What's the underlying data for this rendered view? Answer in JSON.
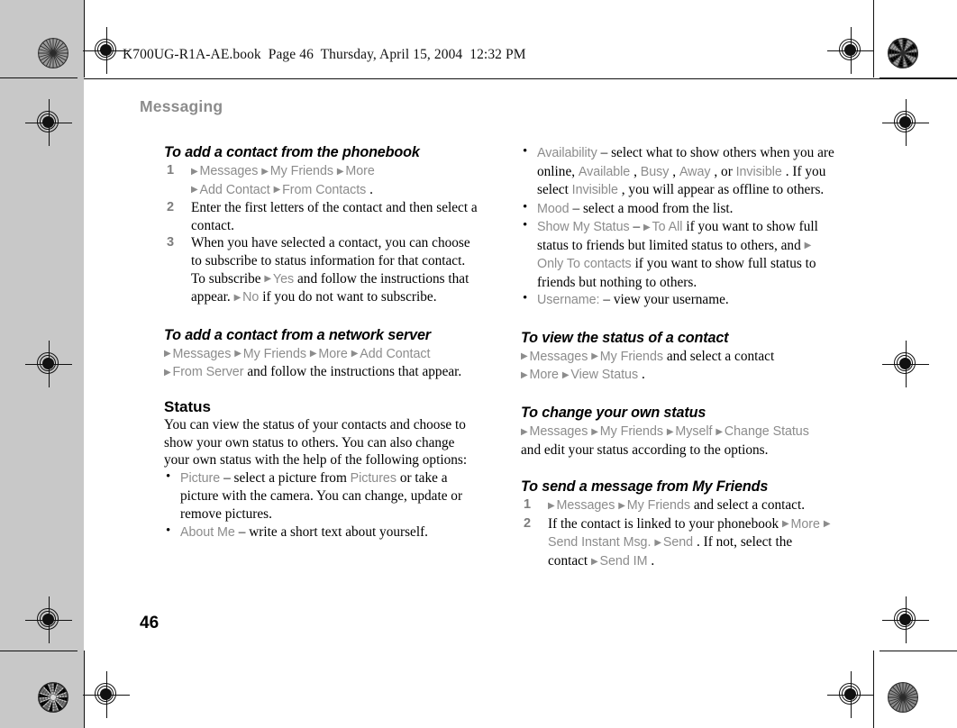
{
  "proof": {
    "file_header": "K700UG-R1A-AE.book  Page 46  Thursday, April 15, 2004  12:32 PM",
    "folio": "46",
    "running_head": "Messaging",
    "arrow_glyph": "▶",
    "bullet_glyph": "•",
    "colors": {
      "ui_gray": "#8c8c8c",
      "head_gray": "#8c8c8c",
      "body_black": "#000000",
      "proof_background": "#c8c8c8",
      "page_white": "#ffffff"
    }
  },
  "left_column": {
    "section_1": {
      "heading": "To add a contact from the phonebook",
      "steps": [
        {
          "number": "1",
          "line1": [
            {
              "t": "arrow"
            },
            {
              "t": "ui",
              "v": "Messages"
            },
            {
              "t": "arrow"
            },
            {
              "t": "ui",
              "v": "My Friends"
            },
            {
              "t": "arrow"
            },
            {
              "t": "ui",
              "v": "More"
            }
          ],
          "line2": [
            {
              "t": "arrow"
            },
            {
              "t": "ui",
              "v": "Add Contact"
            },
            {
              "t": "arrow"
            },
            {
              "t": "ui",
              "v": "From Contacts"
            },
            {
              "t": "text",
              "v": "."
            }
          ]
        },
        {
          "number": "2",
          "text": "Enter the first letters of the contact and then select a contact."
        },
        {
          "number": "3",
          "parts": [
            {
              "t": "text",
              "v": "When you have selected a contact, you can choose to subscribe to status information for that contact. To subscribe "
            },
            {
              "t": "arrow"
            },
            {
              "t": "ui",
              "v": "Yes"
            },
            {
              "t": "text",
              "v": " and follow the instructions that appear. "
            },
            {
              "t": "arrow"
            },
            {
              "t": "ui",
              "v": "No"
            },
            {
              "t": "text",
              "v": " if you do not want to subscribe."
            }
          ]
        }
      ]
    },
    "section_2": {
      "heading": "To add a contact from a network server",
      "body": [
        {
          "t": "arrow"
        },
        {
          "t": "ui",
          "v": "Messages"
        },
        {
          "t": "arrow"
        },
        {
          "t": "ui",
          "v": "My Friends"
        },
        {
          "t": "arrow"
        },
        {
          "t": "ui",
          "v": "More"
        },
        {
          "t": "arrow"
        },
        {
          "t": "ui",
          "v": "Add Contact"
        },
        {
          "t": "break"
        },
        {
          "t": "arrow"
        },
        {
          "t": "ui",
          "v": "From Server"
        },
        {
          "t": "text",
          "v": " and follow the instructions that appear."
        }
      ]
    },
    "section_3": {
      "heading": "Status",
      "intro": "You can view the status of your contacts and choose to show your own status to others. You can also change your own status with the help of the following options:",
      "bullets": [
        [
          {
            "t": "ui",
            "v": "Picture"
          },
          {
            "t": "text",
            "v": " – select a picture from "
          },
          {
            "t": "ui",
            "v": "Pictures"
          },
          {
            "t": "text",
            "v": " or take a picture with the camera. You can change, update or remove pictures."
          }
        ],
        [
          {
            "t": "ui",
            "v": "About Me"
          },
          {
            "t": "text",
            "v": " – write a short text about yourself."
          }
        ]
      ]
    }
  },
  "right_column": {
    "bullets_continued": [
      [
        {
          "t": "ui",
          "v": "Availability"
        },
        {
          "t": "text",
          "v": " – select what to show others when you are online, "
        },
        {
          "t": "ui",
          "v": "Available"
        },
        {
          "t": "text",
          "v": ", "
        },
        {
          "t": "ui",
          "v": "Busy"
        },
        {
          "t": "text",
          "v": ", "
        },
        {
          "t": "ui",
          "v": "Away"
        },
        {
          "t": "text",
          "v": ", or "
        },
        {
          "t": "ui",
          "v": "Invisible"
        },
        {
          "t": "text",
          "v": ". If you select "
        },
        {
          "t": "ui",
          "v": "Invisible"
        },
        {
          "t": "text",
          "v": ", you will appear as offline to others."
        }
      ],
      [
        {
          "t": "ui",
          "v": "Mood"
        },
        {
          "t": "text",
          "v": " – select a mood from the list."
        }
      ],
      [
        {
          "t": "ui",
          "v": "Show My Status"
        },
        {
          "t": "text",
          "v": " – "
        },
        {
          "t": "arrow"
        },
        {
          "t": "ui",
          "v": "To All"
        },
        {
          "t": "text",
          "v": " if you want to show full status to friends but limited status to others, and "
        },
        {
          "t": "arrow"
        },
        {
          "t": "ui",
          "v": "Only To contacts"
        },
        {
          "t": "text",
          "v": " if you want to show full status to friends but nothing to others."
        }
      ],
      [
        {
          "t": "ui",
          "v": "Username:"
        },
        {
          "t": "text",
          "v": " – view your username."
        }
      ]
    ],
    "section_1": {
      "heading": "To view the status of a contact",
      "body": [
        {
          "t": "arrow"
        },
        {
          "t": "ui",
          "v": "Messages"
        },
        {
          "t": "arrow"
        },
        {
          "t": "ui",
          "v": "My Friends"
        },
        {
          "t": "text",
          "v": " and select a contact"
        },
        {
          "t": "break"
        },
        {
          "t": "arrow"
        },
        {
          "t": "ui",
          "v": "More"
        },
        {
          "t": "arrow"
        },
        {
          "t": "ui",
          "v": "View Status"
        },
        {
          "t": "text",
          "v": "."
        }
      ]
    },
    "section_2": {
      "heading": "To change your own status",
      "body": [
        {
          "t": "arrow"
        },
        {
          "t": "ui",
          "v": "Messages"
        },
        {
          "t": "arrow"
        },
        {
          "t": "ui",
          "v": "My Friends"
        },
        {
          "t": "arrow"
        },
        {
          "t": "ui",
          "v": "Myself"
        },
        {
          "t": "arrow"
        },
        {
          "t": "ui",
          "v": "Change Status"
        },
        {
          "t": "break"
        },
        {
          "t": "text",
          "v": "and edit your status according to the options."
        }
      ]
    },
    "section_3": {
      "heading": "To send a message from My Friends",
      "steps": [
        {
          "number": "1",
          "parts": [
            {
              "t": "arrow"
            },
            {
              "t": "ui",
              "v": "Messages"
            },
            {
              "t": "arrow"
            },
            {
              "t": "ui",
              "v": "My Friends"
            },
            {
              "t": "text",
              "v": " and select a contact."
            }
          ]
        },
        {
          "number": "2",
          "parts": [
            {
              "t": "text",
              "v": "If the contact is linked to your phonebook "
            },
            {
              "t": "arrow"
            },
            {
              "t": "ui",
              "v": "More"
            },
            {
              "t": "arrow"
            },
            {
              "t": "ui",
              "v": "Send Instant Msg."
            },
            {
              "t": "arrow"
            },
            {
              "t": "ui",
              "v": "Send"
            },
            {
              "t": "text",
              "v": ". If not, select the contact "
            },
            {
              "t": "arrow"
            },
            {
              "t": "ui",
              "v": "Send IM"
            },
            {
              "t": "text",
              "v": "."
            }
          ]
        }
      ]
    }
  }
}
